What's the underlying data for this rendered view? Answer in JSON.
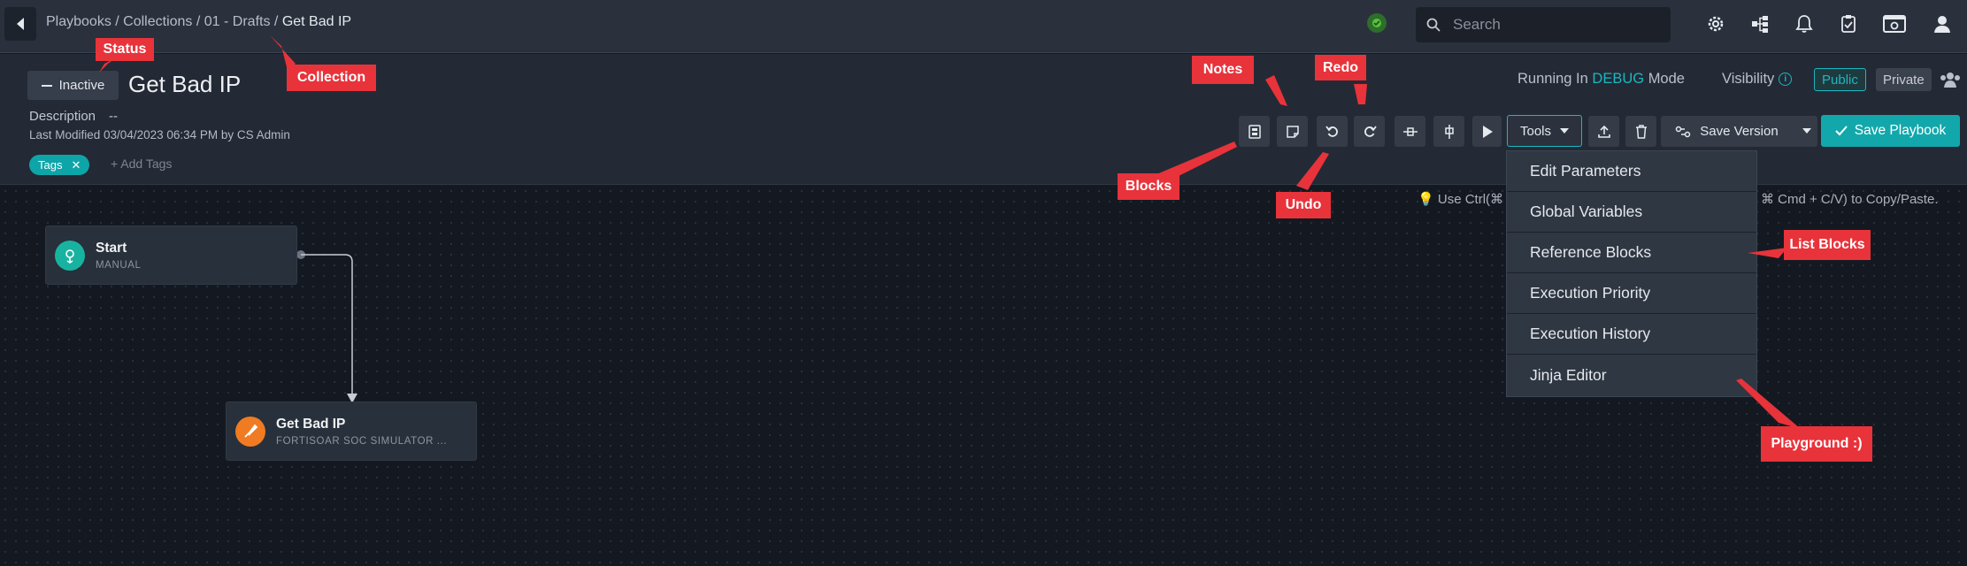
{
  "topbar": {
    "breadcrumb": [
      "Playbooks",
      "Collections",
      "01 - Drafts",
      "Get Bad IP"
    ],
    "separator": " / ",
    "search_placeholder": "Search"
  },
  "header": {
    "status_label": "Inactive",
    "title": "Get Bad IP",
    "description_label": "Description",
    "description_value": "--",
    "last_modified": "Last Modified 03/04/2023 06:34 PM by CS Admin",
    "tag": "Tags",
    "add_tags": "+ Add Tags",
    "running_prefix": "Running In",
    "running_mode": "DEBUG",
    "running_suffix": "Mode",
    "visibility_label": "Visibility",
    "visibility_public": "Public",
    "visibility_private": "Private"
  },
  "toolbar": {
    "tools_label": "Tools",
    "save_version_label": "Save Version",
    "save_playbook_label": "Save Playbook"
  },
  "tools_menu": {
    "items": [
      "Edit Parameters",
      "Global Variables",
      "Reference Blocks",
      "Execution Priority",
      "Execution History",
      "Jinja Editor"
    ]
  },
  "canvas": {
    "hint_left": "Use Ctrl(⌘",
    "hint_right": "⌘ Cmd + C/V) to Copy/Paste.",
    "nodes": [
      {
        "title": "Start",
        "subtitle": "MANUAL"
      },
      {
        "title": "Get Bad IP",
        "subtitle": "FORTISOAR SOC SIMULATOR ..."
      }
    ]
  },
  "callouts": {
    "status": "Status",
    "collection": "Collection",
    "notes": "Notes",
    "redo": "Redo",
    "blocks": "Blocks",
    "undo": "Undo",
    "list_blocks": "List Blocks",
    "playground": "Playground :)"
  },
  "colors": {
    "accent": "#1bb7c0",
    "save_button": "#12a8ab",
    "callout": "#e8333b",
    "start_node_icon": "#18b3a0",
    "connector_node_icon": "#f07b22"
  }
}
